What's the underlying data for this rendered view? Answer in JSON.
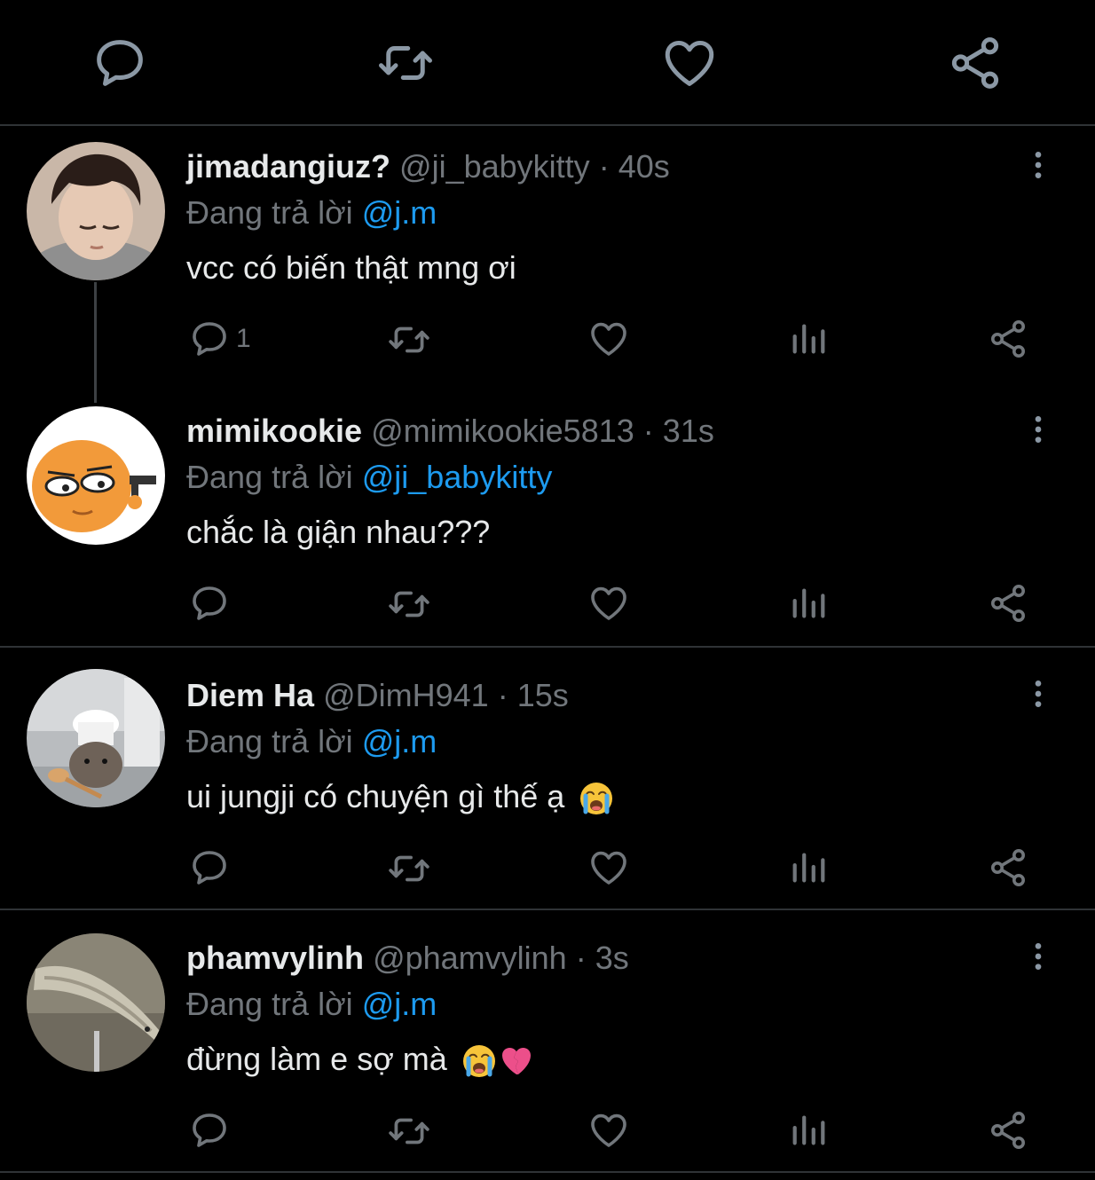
{
  "top_actions": {
    "reply_icon": "reply-icon",
    "retweet_icon": "retweet-icon",
    "like_icon": "like-icon",
    "share_icon": "share-icon"
  },
  "colors": {
    "background": "#000000",
    "text": "#e7e9ea",
    "muted": "#71767b",
    "accent": "#1d9bf0",
    "divider": "#2f3336"
  },
  "tweets": [
    {
      "name": "jimadangiuz?",
      "handle": "@ji_babykitty",
      "separator": "·",
      "time": "40s",
      "reply_prefix": "Đang trả lời",
      "reply_to": "@j.m",
      "text": "vcc có biến thật mng ơi",
      "reply_count": "1"
    },
    {
      "name": "mimikookie",
      "handle": "@mimikookie5813",
      "separator": "·",
      "time": "31s",
      "reply_prefix": "Đang trả lời",
      "reply_to": "@ji_babykitty",
      "text": "chắc là giận nhau???",
      "reply_count": ""
    },
    {
      "name": "Diem Ha",
      "handle": "@DimH941",
      "separator": "·",
      "time": "15s",
      "reply_prefix": "Đang trả lời",
      "reply_to": "@j.m",
      "text": "ui jungji có chuyện gì thế ạ",
      "reply_count": "",
      "emoji": [
        "crying-face-emoji"
      ]
    },
    {
      "name": "phamvylinh",
      "handle": "@phamvylinh",
      "separator": "·",
      "time": "3s",
      "reply_prefix": "Đang trả lời",
      "reply_to": "@j.m",
      "text": "đừng làm e sợ mà",
      "reply_count": "",
      "emoji": [
        "crying-face-emoji",
        "broken-heart-emoji"
      ]
    }
  ]
}
